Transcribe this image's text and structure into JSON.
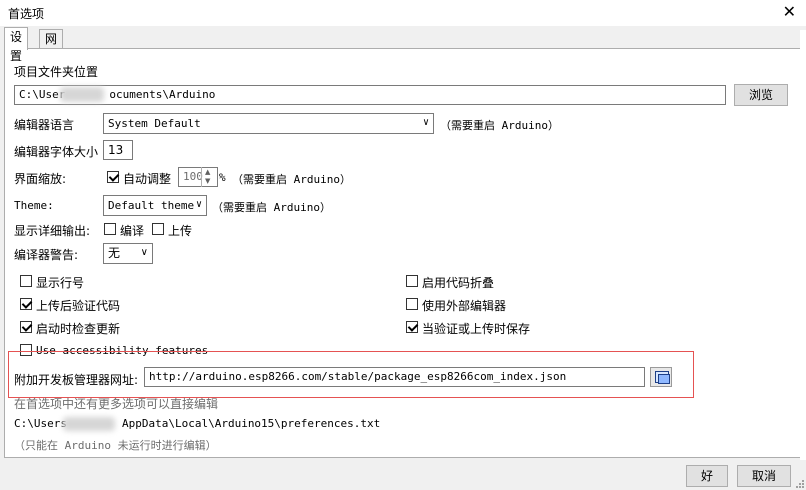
{
  "window": {
    "title": "首选项",
    "close_glyph": "✕"
  },
  "tabs": [
    {
      "label": "设置"
    },
    {
      "label": "网络"
    }
  ],
  "sketchbook": {
    "label": "项目文件夹位置",
    "path_prefix": "C:\\User",
    "path_suffix": "ocuments\\Arduino",
    "browse_label": "浏览"
  },
  "editor_language": {
    "label": "编辑器语言",
    "value": "System Default",
    "note": "（需要重启 Arduino）"
  },
  "editor_font_size": {
    "label": "编辑器字体大小",
    "value": "13"
  },
  "interface_scale": {
    "label": "界面缩放:",
    "auto_label": "自动调整",
    "auto_checked": true,
    "value": "100",
    "unit": "%",
    "note": "（需要重启 Arduino）"
  },
  "theme": {
    "label": "Theme:",
    "value": "Default theme",
    "note": "（需要重启 Arduino）"
  },
  "verbose_output": {
    "label": "显示详细输出:",
    "compile_label": "编译",
    "compile_checked": false,
    "upload_label": "上传",
    "upload_checked": false
  },
  "compiler_warnings": {
    "label": "编译器警告:",
    "value": "无"
  },
  "options": {
    "left": [
      {
        "label": "显示行号",
        "checked": false
      },
      {
        "label": "上传后验证代码",
        "checked": true
      },
      {
        "label": "启动时检查更新",
        "checked": true
      },
      {
        "label": "Use accessibility features",
        "checked": false
      }
    ],
    "right": [
      {
        "label": "启用代码折叠",
        "checked": false
      },
      {
        "label": "使用外部编辑器",
        "checked": false
      },
      {
        "label": "当验证或上传时保存",
        "checked": true
      }
    ]
  },
  "board_manager": {
    "label": "附加开发板管理器网址:",
    "value": "http://arduino.esp8266.com/stable/package_esp8266com_index.json"
  },
  "more_prefs_note": "在首选项中还有更多选项可以直接编辑",
  "prefs_path": {
    "prefix": "C:\\Users",
    "suffix": "AppData\\Local\\Arduino15\\preferences.txt"
  },
  "edit_note": "（只能在 Arduino 未运行时进行编辑）",
  "footer": {
    "ok_label": "好",
    "cancel_label": "取消"
  }
}
